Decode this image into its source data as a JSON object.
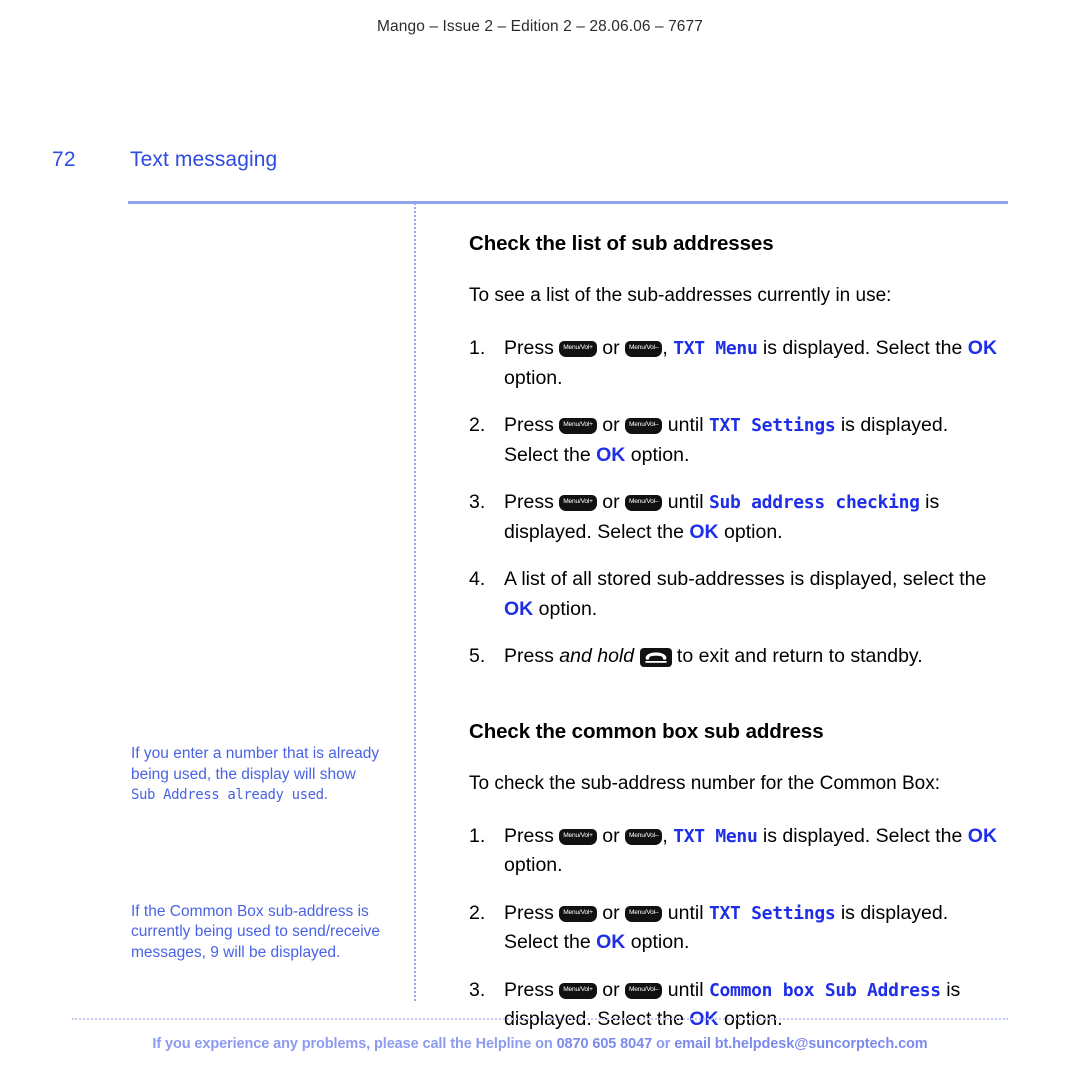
{
  "running_head": "Mango – Issue 2 – Edition 2 – 28.06.06 – 7677",
  "page": {
    "folio": "72",
    "chapter_title": "Text messaging"
  },
  "colors": {
    "heading_blue": "#2d4be0",
    "lcd_blue": "#1f2fe8",
    "note_blue": "#4a63e4",
    "rule_blue": "#93a3f2",
    "footer_blue": "#8d9bef"
  },
  "icons": {
    "menu_vol_up": "Menu/Vol+",
    "menu_vol_down": "Menu/Vol–",
    "hangup": "hangup-key-icon"
  },
  "sections": [
    {
      "heading": "Check the list of sub addresses",
      "lead": "To see a list of the sub-addresses currently in use:",
      "steps": [
        {
          "pre": "Press ",
          "mid": " or ",
          "after_keys": ", ",
          "lcd": "TXT Menu",
          "post": " is displayed. Select the ",
          "ok": "OK",
          "tail": " option."
        },
        {
          "pre": "Press ",
          "mid": " or ",
          "after_keys": " until ",
          "lcd": "TXT Settings",
          "post": " is displayed. Select the ",
          "ok": "OK",
          "tail": " option."
        },
        {
          "pre": "Press ",
          "mid": " or ",
          "after_keys": " until ",
          "lcd": "Sub address checking",
          "post": " is displayed. Select the ",
          "ok": "OK",
          "tail": " option."
        },
        {
          "plain_pre": "A list of all stored sub-addresses is displayed, select the ",
          "ok": "OK",
          "tail": " option."
        },
        {
          "press": "Press ",
          "italic": "and hold",
          "space": " ",
          "tail": " to exit and return to standby."
        }
      ]
    },
    {
      "heading": "Check the common box sub address",
      "lead": "To check the sub-address number for the Common Box:",
      "steps": [
        {
          "pre": "Press ",
          "mid": " or ",
          "after_keys": ", ",
          "lcd": "TXT Menu",
          "post": " is displayed. Select the ",
          "ok": "OK",
          "tail": " option."
        },
        {
          "pre": "Press ",
          "mid": " or ",
          "after_keys": " until ",
          "lcd": "TXT Settings",
          "post": " is displayed. Select the ",
          "ok": "OK",
          "tail": " option."
        },
        {
          "pre": "Press ",
          "mid": " or ",
          "after_keys": " until ",
          "lcd": "Common box Sub Address",
          "post": " is displayed. Select the ",
          "ok": "OK",
          "tail": " option."
        }
      ]
    }
  ],
  "sidenotes": [
    {
      "text_before": "If you enter a number that is already being used, the display will show ",
      "lcd": "Sub Address already used",
      "text_after": "."
    },
    {
      "text_before": "If the Common Box sub-address is currently being used to send/receive messages, 9 will be displayed.",
      "lcd": "",
      "text_after": ""
    }
  ],
  "footer": {
    "part1": "If you experience any problems, please call the Helpline on ",
    "phone": "0870 605 8047",
    "part2": " or ",
    "email": "email bt.helpdesk@suncorptech.com"
  }
}
